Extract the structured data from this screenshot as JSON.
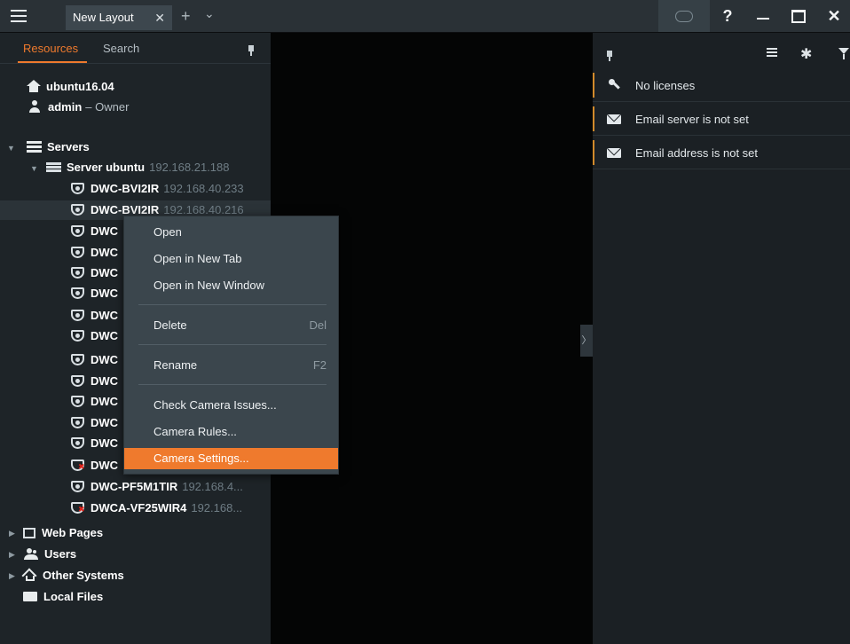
{
  "titlebar": {
    "tab_label": "New Layout",
    "tab_close": "✕",
    "add_tab": "+",
    "tab_list": "⌄",
    "help": "?",
    "close": "✕"
  },
  "left_panel": {
    "tabs": {
      "resources": "Resources",
      "search": "Search"
    },
    "system_name": "ubuntu16.04",
    "user": {
      "name": "admin",
      "role": "– Owner"
    },
    "servers_label": "Servers",
    "server": {
      "name": "Server ubuntu",
      "ip": "192.168.21.188"
    },
    "devices": [
      {
        "name": "DWC-BVI2IR",
        "ip": "192.168.40.233"
      },
      {
        "name": "DWC-BVI2IR",
        "ip": "192.168.40.216"
      },
      {
        "name": "DWC",
        "ip": ""
      },
      {
        "name": "DWC",
        "ip": ""
      },
      {
        "name": "DWC",
        "ip": ""
      },
      {
        "name": "DWC",
        "ip": ""
      },
      {
        "name": "DWC",
        "ip": ""
      },
      {
        "name": "DWC",
        "ip": ""
      },
      {
        "name": "DWC",
        "ip": ""
      },
      {
        "name": "DWC",
        "ip": ""
      },
      {
        "name": "DWC",
        "ip": ""
      },
      {
        "name": "DWC",
        "ip": ""
      },
      {
        "name": "DWC",
        "ip": ""
      },
      {
        "name": "DWC",
        "ip": ""
      },
      {
        "name": "DWC-PF5M1TIR",
        "ip": "192.168.4..."
      },
      {
        "name": "DWCA-VF25WIR4",
        "ip": "192.168..."
      }
    ],
    "groups": {
      "web_pages": "Web Pages",
      "users": "Users",
      "other_systems": "Other Systems",
      "local_files": "Local Files"
    }
  },
  "context_menu": {
    "open": "Open",
    "open_new_tab": "Open in New Tab",
    "open_new_window": "Open in New Window",
    "delete": "Delete",
    "delete_key": "Del",
    "rename": "Rename",
    "rename_key": "F2",
    "check_issues": "Check Camera Issues...",
    "camera_rules": "Camera Rules...",
    "camera_settings": "Camera Settings..."
  },
  "notifications": {
    "items": [
      {
        "icon": "key-icon",
        "text": "No licenses"
      },
      {
        "icon": "mail-icon",
        "text": "Email server is not set"
      },
      {
        "icon": "mail-icon",
        "text": "Email address is not set"
      }
    ]
  },
  "colors": {
    "accent": "#ef7a2d",
    "error": "#e2221a",
    "notification_bar": "#d28a2b"
  }
}
